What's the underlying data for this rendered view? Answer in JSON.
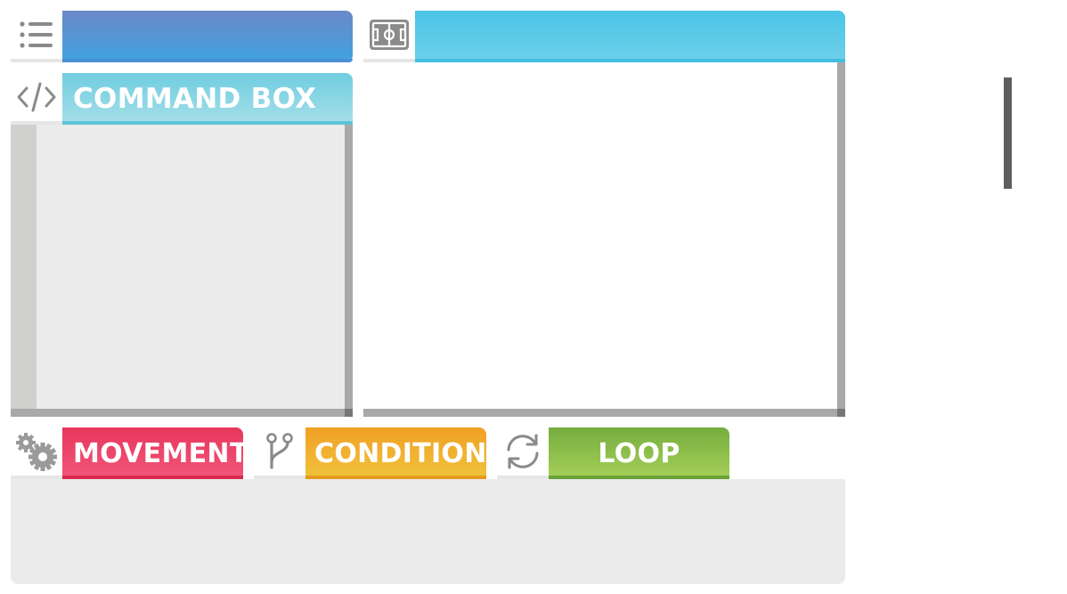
{
  "menu": {
    "icon": "list-icon",
    "title": ""
  },
  "stage": {
    "icon": "soccer-field-icon",
    "title": ""
  },
  "command_box": {
    "icon": "code-icon",
    "title": "COMMAND BOX"
  },
  "categories": [
    {
      "label": "MOVEMENT",
      "icon": "gears-icon",
      "color": "#e8365c"
    },
    {
      "label": "CONDITION",
      "icon": "branch-icon",
      "color": "#f1a024"
    },
    {
      "label": "LOOP",
      "icon": "refresh-icon",
      "color": "#75ad3e"
    }
  ],
  "colors": {
    "menu_header": "#4fa0dc",
    "stage_header": "#4bc4e6",
    "command_header": "#6fcde0",
    "panel_bg": "#ebebeb",
    "scrollbar": "#a9a9a9",
    "icon_gray": "#888888"
  }
}
